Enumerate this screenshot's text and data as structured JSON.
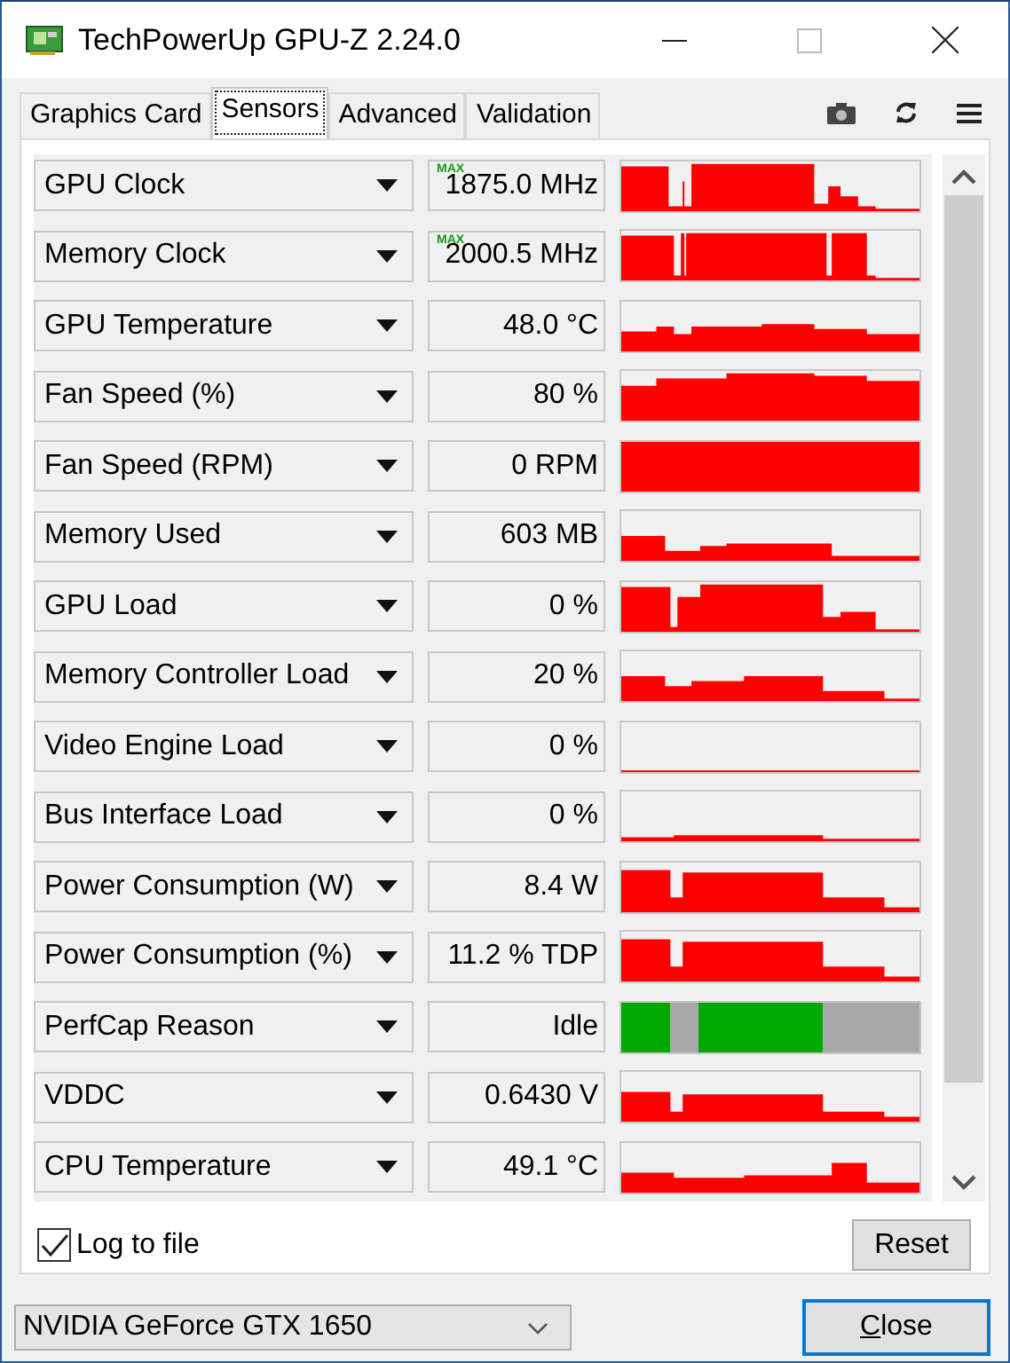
{
  "window": {
    "title": "TechPowerUp GPU-Z 2.24.0"
  },
  "tabs": [
    {
      "label": "Graphics Card",
      "selected": false
    },
    {
      "label": "Sensors",
      "selected": true
    },
    {
      "label": "Advanced",
      "selected": false
    },
    {
      "label": "Validation",
      "selected": false
    }
  ],
  "sensors": [
    {
      "name": "GPU Clock",
      "value": "1875.0 MHz",
      "badge": "MAX",
      "kind": "area"
    },
    {
      "name": "Memory Clock",
      "value": "2000.5 MHz",
      "badge": "MAX",
      "kind": "area"
    },
    {
      "name": "GPU Temperature",
      "value": "48.0 °C",
      "kind": "area"
    },
    {
      "name": "Fan Speed (%)",
      "value": "80 %",
      "kind": "area"
    },
    {
      "name": "Fan Speed (RPM)",
      "value": "0 RPM",
      "kind": "area"
    },
    {
      "name": "Memory Used",
      "value": "603 MB",
      "kind": "area"
    },
    {
      "name": "GPU Load",
      "value": "0 %",
      "kind": "area"
    },
    {
      "name": "Memory Controller Load",
      "value": "20 %",
      "kind": "area"
    },
    {
      "name": "Video Engine Load",
      "value": "0 %",
      "kind": "area"
    },
    {
      "name": "Bus Interface Load",
      "value": "0 %",
      "kind": "area"
    },
    {
      "name": "Power Consumption (W)",
      "value": "8.4 W",
      "kind": "area"
    },
    {
      "name": "Power Consumption (%)",
      "value": "11.2 % TDP",
      "kind": "area"
    },
    {
      "name": "PerfCap Reason",
      "value": "Idle",
      "kind": "perfcap"
    },
    {
      "name": "VDDC",
      "value": "0.6430 V",
      "kind": "area"
    },
    {
      "name": "CPU Temperature",
      "value": "49.1 °C",
      "kind": "area"
    }
  ],
  "log_to_file": {
    "label": "Log to file",
    "checked": true
  },
  "reset_button": "Reset",
  "gpu_select": {
    "value": "NVIDIA GeForce GTX 1650"
  },
  "close_button": "Close"
}
